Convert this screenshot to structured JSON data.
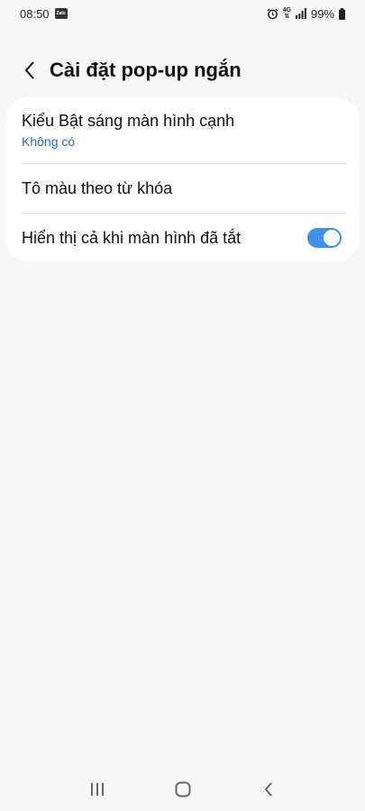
{
  "status_bar": {
    "time": "08:50",
    "app_notification": "Zalo",
    "network": "4G",
    "battery": "99%"
  },
  "app_bar": {
    "title": "Cài đặt pop-up ngắn"
  },
  "settings": {
    "items": [
      {
        "title": "Kiểu Bật sáng màn hình cạnh",
        "subtitle": "Không có"
      },
      {
        "title": "Tô màu theo từ khóa"
      },
      {
        "title": "Hiển thị cả khi màn hình đã tắt",
        "toggle_on": true
      }
    ]
  },
  "colors": {
    "accent": "#3e91ea",
    "subtitle": "#1a73c9",
    "background": "#f7f7f7",
    "card": "#ffffff"
  },
  "icons": {
    "back": "chevron-left-icon",
    "recents": "recents-icon",
    "home": "home-icon",
    "nav_back": "back-icon"
  }
}
